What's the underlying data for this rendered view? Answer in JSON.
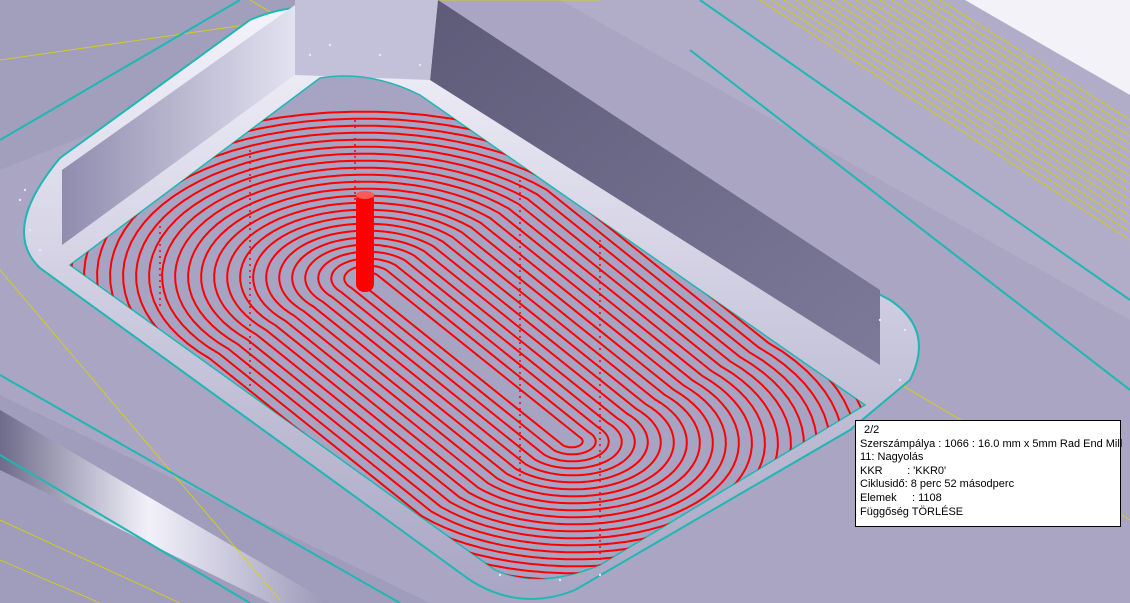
{
  "viewport": {
    "background": "#a9a5c2",
    "toolpath_color": "#ff0000",
    "edge_color": "#1fb7b4",
    "reference_line_color": "#dcd400"
  },
  "info_box": {
    "pager": "2/2",
    "lines": [
      "Szerszámpálya : 1066 : 16.0 mm x 5mm Rad End Mill",
      "11: Nagyolás",
      "KKR        : 'KKR0'",
      "Ciklusidő: 8 perc 52 másodperc",
      "Elemek     : 1108",
      "Függőség TÖRLÉSE"
    ]
  }
}
